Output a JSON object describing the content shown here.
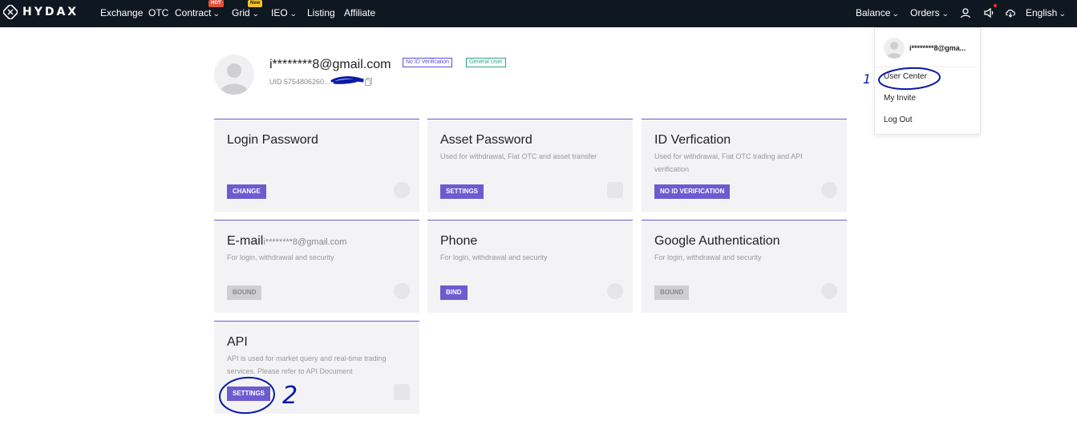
{
  "header": {
    "logo_text": "HYDAX",
    "nav": {
      "exchange": "Exchange",
      "otc": "OTC",
      "contract": "Contract",
      "contract_tag": "HOT",
      "grid": "Grid",
      "grid_tag": "New",
      "ieo": "IEO",
      "listing": "Listing",
      "affiliate": "Affiliate"
    },
    "right": {
      "balance": "Balance",
      "orders": "Orders",
      "language": "English"
    },
    "chevron": "⌄"
  },
  "profile": {
    "email": "i********8@gmail.com",
    "badge_id": "No ID Verification",
    "badge_user": "General User",
    "uid": "UID 5754806260..."
  },
  "cards": {
    "login_password": {
      "title": "Login Password",
      "button": "CHANGE"
    },
    "asset_password": {
      "title": "Asset Password",
      "desc": "Used for withdrawal, Fiat OTC and asset transfer",
      "button": "SETTINGS"
    },
    "id_verification": {
      "title": "ID Verfication",
      "desc": "Used for withdrawal, Fiat OTC trading and API verification",
      "button": "NO ID VERIFICATION"
    },
    "email": {
      "title": "E-mail",
      "value": "i********8@gmail.com",
      "desc": "For login, withdrawal and security",
      "button": "BOUND"
    },
    "phone": {
      "title": "Phone",
      "desc": "For login, withdrawal and security",
      "button": "BIND"
    },
    "google_auth": {
      "title": "Google Authentication",
      "desc": "For login, withdrawal and security",
      "button": "BOUND"
    },
    "api": {
      "title": "API",
      "desc": "API is used for market query and real-time trading services. Please refer to API Document",
      "button": "SETTINGS"
    }
  },
  "dropdown": {
    "email": "i********8@gma...",
    "items": [
      "User Center",
      "My Invite",
      "Log Out"
    ]
  },
  "annotations": {
    "num1": "1",
    "num2": "2",
    "ink_color": "#0a1aa8"
  },
  "colors": {
    "accent": "#6d5bd0",
    "topbar": "#0f1720",
    "badge_green": "#2fa58a"
  }
}
